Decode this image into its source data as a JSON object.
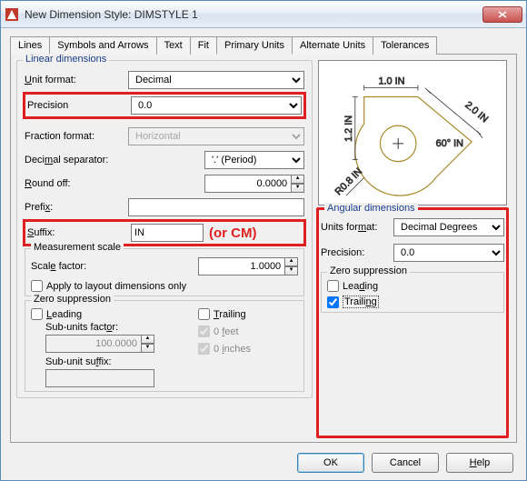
{
  "window": {
    "title": "New Dimension Style: DIMSTYLE 1"
  },
  "tabs": {
    "items": [
      "Lines",
      "Symbols and Arrows",
      "Text",
      "Fit",
      "Primary Units",
      "Alternate Units",
      "Tolerances"
    ],
    "active": 4
  },
  "linear": {
    "legend": "Linear dimensions",
    "unit_format_label": "Unit format:",
    "unit_format_value": "Decimal",
    "precision_label": "Precision",
    "precision_value": "0.0",
    "fraction_label": "Fraction format:",
    "fraction_value": "Horizontal",
    "decimal_sep_label": "Decimal separator:",
    "decimal_sep_value": "'.' (Period)",
    "round_label": "Round off:",
    "round_value": "0.0000",
    "prefix_label": "Prefix:",
    "prefix_value": "",
    "suffix_label": "Suffix:",
    "suffix_value": "IN",
    "suffix_annot": "(or CM)"
  },
  "meas": {
    "legend": "Measurement scale",
    "scale_label": "Scale factor:",
    "scale_value": "1.0000",
    "apply_label": "Apply to layout dimensions only",
    "apply_checked": false
  },
  "zero": {
    "legend": "Zero suppression",
    "leading_label": "Leading",
    "leading_checked": false,
    "trailing_label": "Trailing",
    "trailing_checked": false,
    "subfactor_label": "Sub-units factor:",
    "subfactor_value": "100.0000",
    "subsuffix_label": "Sub-unit suffix:",
    "subsuffix_value": "",
    "feet_label": "0 feet",
    "feet_checked": true,
    "inches_label": "0 inches",
    "inches_checked": true
  },
  "angular": {
    "legend": "Angular dimensions",
    "units_label": "Units format:",
    "units_value": "Decimal Degrees",
    "precision_label": "Precision:",
    "precision_value": "0.0",
    "zero_legend": "Zero suppression",
    "leading_label": "Leading",
    "leading_checked": false,
    "trailing_label": "Trailing",
    "trailing_checked": true
  },
  "preview": {
    "dim_top": "1.0  IN",
    "dim_left": "1.2  IN",
    "dim_diag": "2.0  IN",
    "dim_angle": "60°  IN",
    "dim_radius": "R0.8  IN"
  },
  "buttons": {
    "ok": "OK",
    "cancel": "Cancel",
    "help": "Help"
  }
}
